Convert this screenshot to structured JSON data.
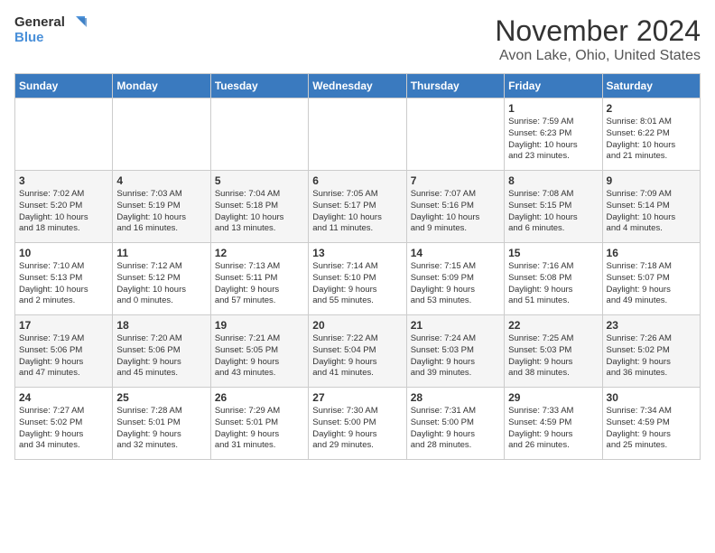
{
  "logo": {
    "line1": "General",
    "line2": "Blue"
  },
  "title": "November 2024",
  "location": "Avon Lake, Ohio, United States",
  "weekdays": [
    "Sunday",
    "Monday",
    "Tuesday",
    "Wednesday",
    "Thursday",
    "Friday",
    "Saturday"
  ],
  "weeks": [
    [
      {
        "day": "",
        "info": ""
      },
      {
        "day": "",
        "info": ""
      },
      {
        "day": "",
        "info": ""
      },
      {
        "day": "",
        "info": ""
      },
      {
        "day": "",
        "info": ""
      },
      {
        "day": "1",
        "info": "Sunrise: 7:59 AM\nSunset: 6:23 PM\nDaylight: 10 hours\nand 23 minutes."
      },
      {
        "day": "2",
        "info": "Sunrise: 8:01 AM\nSunset: 6:22 PM\nDaylight: 10 hours\nand 21 minutes."
      }
    ],
    [
      {
        "day": "3",
        "info": "Sunrise: 7:02 AM\nSunset: 5:20 PM\nDaylight: 10 hours\nand 18 minutes."
      },
      {
        "day": "4",
        "info": "Sunrise: 7:03 AM\nSunset: 5:19 PM\nDaylight: 10 hours\nand 16 minutes."
      },
      {
        "day": "5",
        "info": "Sunrise: 7:04 AM\nSunset: 5:18 PM\nDaylight: 10 hours\nand 13 minutes."
      },
      {
        "day": "6",
        "info": "Sunrise: 7:05 AM\nSunset: 5:17 PM\nDaylight: 10 hours\nand 11 minutes."
      },
      {
        "day": "7",
        "info": "Sunrise: 7:07 AM\nSunset: 5:16 PM\nDaylight: 10 hours\nand 9 minutes."
      },
      {
        "day": "8",
        "info": "Sunrise: 7:08 AM\nSunset: 5:15 PM\nDaylight: 10 hours\nand 6 minutes."
      },
      {
        "day": "9",
        "info": "Sunrise: 7:09 AM\nSunset: 5:14 PM\nDaylight: 10 hours\nand 4 minutes."
      }
    ],
    [
      {
        "day": "10",
        "info": "Sunrise: 7:10 AM\nSunset: 5:13 PM\nDaylight: 10 hours\nand 2 minutes."
      },
      {
        "day": "11",
        "info": "Sunrise: 7:12 AM\nSunset: 5:12 PM\nDaylight: 10 hours\nand 0 minutes."
      },
      {
        "day": "12",
        "info": "Sunrise: 7:13 AM\nSunset: 5:11 PM\nDaylight: 9 hours\nand 57 minutes."
      },
      {
        "day": "13",
        "info": "Sunrise: 7:14 AM\nSunset: 5:10 PM\nDaylight: 9 hours\nand 55 minutes."
      },
      {
        "day": "14",
        "info": "Sunrise: 7:15 AM\nSunset: 5:09 PM\nDaylight: 9 hours\nand 53 minutes."
      },
      {
        "day": "15",
        "info": "Sunrise: 7:16 AM\nSunset: 5:08 PM\nDaylight: 9 hours\nand 51 minutes."
      },
      {
        "day": "16",
        "info": "Sunrise: 7:18 AM\nSunset: 5:07 PM\nDaylight: 9 hours\nand 49 minutes."
      }
    ],
    [
      {
        "day": "17",
        "info": "Sunrise: 7:19 AM\nSunset: 5:06 PM\nDaylight: 9 hours\nand 47 minutes."
      },
      {
        "day": "18",
        "info": "Sunrise: 7:20 AM\nSunset: 5:06 PM\nDaylight: 9 hours\nand 45 minutes."
      },
      {
        "day": "19",
        "info": "Sunrise: 7:21 AM\nSunset: 5:05 PM\nDaylight: 9 hours\nand 43 minutes."
      },
      {
        "day": "20",
        "info": "Sunrise: 7:22 AM\nSunset: 5:04 PM\nDaylight: 9 hours\nand 41 minutes."
      },
      {
        "day": "21",
        "info": "Sunrise: 7:24 AM\nSunset: 5:03 PM\nDaylight: 9 hours\nand 39 minutes."
      },
      {
        "day": "22",
        "info": "Sunrise: 7:25 AM\nSunset: 5:03 PM\nDaylight: 9 hours\nand 38 minutes."
      },
      {
        "day": "23",
        "info": "Sunrise: 7:26 AM\nSunset: 5:02 PM\nDaylight: 9 hours\nand 36 minutes."
      }
    ],
    [
      {
        "day": "24",
        "info": "Sunrise: 7:27 AM\nSunset: 5:02 PM\nDaylight: 9 hours\nand 34 minutes."
      },
      {
        "day": "25",
        "info": "Sunrise: 7:28 AM\nSunset: 5:01 PM\nDaylight: 9 hours\nand 32 minutes."
      },
      {
        "day": "26",
        "info": "Sunrise: 7:29 AM\nSunset: 5:01 PM\nDaylight: 9 hours\nand 31 minutes."
      },
      {
        "day": "27",
        "info": "Sunrise: 7:30 AM\nSunset: 5:00 PM\nDaylight: 9 hours\nand 29 minutes."
      },
      {
        "day": "28",
        "info": "Sunrise: 7:31 AM\nSunset: 5:00 PM\nDaylight: 9 hours\nand 28 minutes."
      },
      {
        "day": "29",
        "info": "Sunrise: 7:33 AM\nSunset: 4:59 PM\nDaylight: 9 hours\nand 26 minutes."
      },
      {
        "day": "30",
        "info": "Sunrise: 7:34 AM\nSunset: 4:59 PM\nDaylight: 9 hours\nand 25 minutes."
      }
    ]
  ]
}
